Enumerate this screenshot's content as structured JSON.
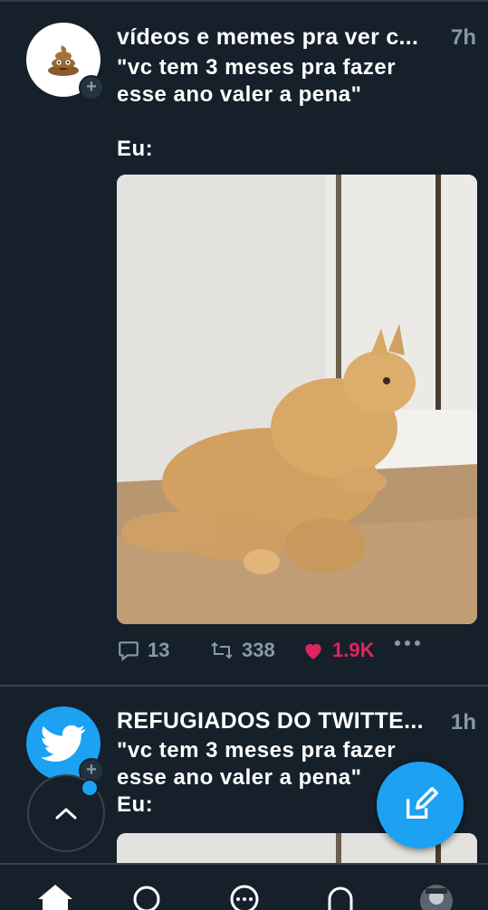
{
  "colors": {
    "background": "#15202b",
    "accent": "#1da1f2",
    "like": "#e0245e",
    "muted": "#8899a6"
  },
  "tweets": [
    {
      "avatar_icon": "poop-emoji-icon",
      "name": "vídeos e memes pra ver c...",
      "time": "7h",
      "text": "\"vc tem 3 meses pra fazer\nesse ano valer a pena\"\n\nEu:",
      "reply_count": "13",
      "retweet_count": "338",
      "like_count": "1.9K"
    },
    {
      "avatar_icon": "twitter-bird-icon",
      "name": "REFUGIADOS DO TWITTE...",
      "time": "1h",
      "text": "\"vc tem 3 meses pra fazer\nesse ano valer a pena\"\nEu:"
    }
  ],
  "nav": {
    "items": [
      "home-icon",
      "search-icon",
      "spaces-icon",
      "notifications-icon",
      "profile-avatar-icon"
    ]
  }
}
